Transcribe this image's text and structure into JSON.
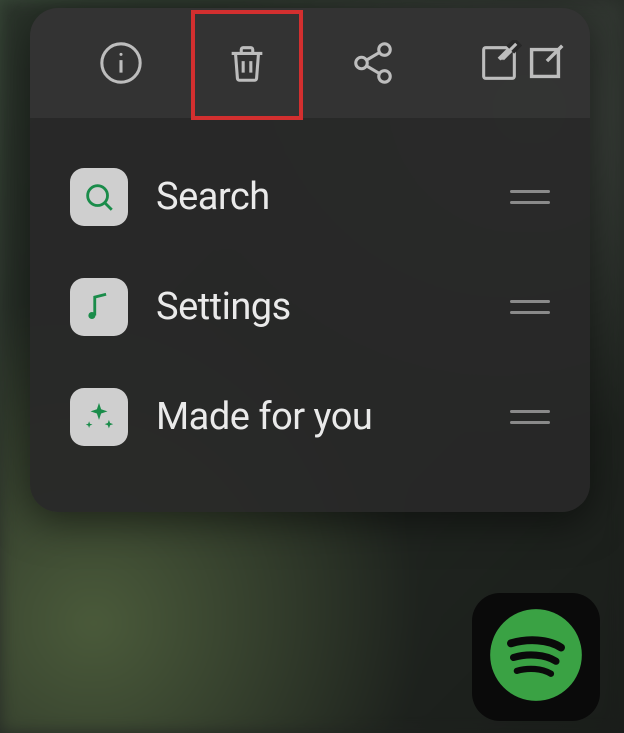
{
  "toolbar": {
    "items": [
      {
        "name": "info-button",
        "icon": "info-icon"
      },
      {
        "name": "delete-button",
        "icon": "trash-icon",
        "highlighted": true
      },
      {
        "name": "share-button",
        "icon": "share-icon"
      },
      {
        "name": "edit-button",
        "icon": "edit-icon"
      }
    ]
  },
  "shortcuts": [
    {
      "label": "Search",
      "icon": "search-icon"
    },
    {
      "label": "Settings",
      "icon": "music-note-icon"
    },
    {
      "label": "Made for you",
      "icon": "sparkle-icon"
    }
  ],
  "accent_color": "#1db954",
  "app_icon_name": "spotify-icon"
}
